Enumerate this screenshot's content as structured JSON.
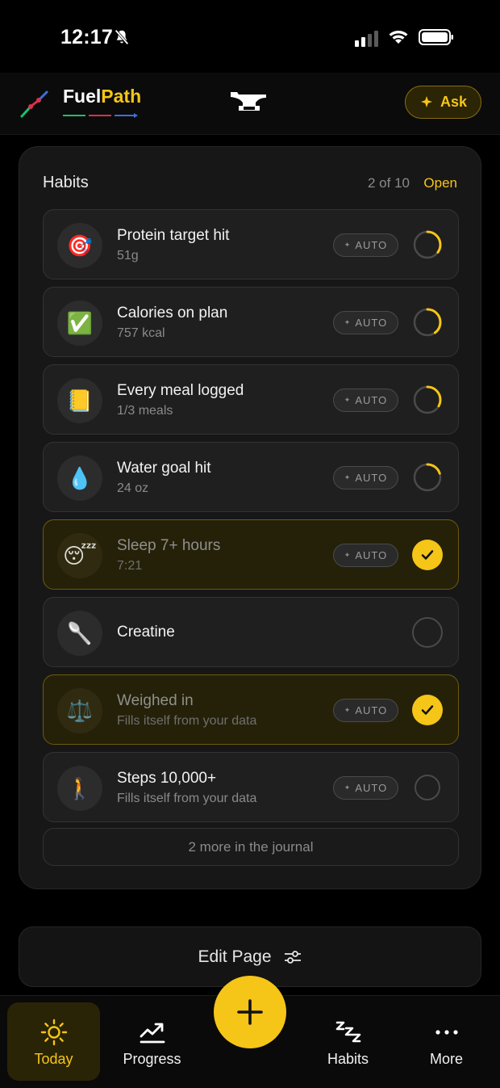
{
  "status": {
    "time": "12:17"
  },
  "header": {
    "brand_part1": "Fuel",
    "brand_part2": "Path",
    "ask_label": "Ask"
  },
  "habits_card": {
    "title": "Habits",
    "count": "2 of 10",
    "open_label": "Open",
    "auto_label": "AUTO",
    "items": [
      {
        "emoji": "🎯",
        "name": "Protein target hit",
        "sub": "51g",
        "state": "partial",
        "progress": 0.35
      },
      {
        "emoji": "✅",
        "name": "Calories on plan",
        "sub": "757 kcal",
        "state": "partial",
        "progress": 0.4
      },
      {
        "emoji": "📒",
        "name": "Every meal logged",
        "sub": "1/3 meals",
        "state": "partial",
        "progress": 0.33
      },
      {
        "emoji": "💧",
        "name": "Water goal hit",
        "sub": "24 oz",
        "state": "partial",
        "progress": 0.2
      },
      {
        "emoji": "😴",
        "name": "Sleep 7+ hours",
        "sub": "7:21",
        "state": "done"
      },
      {
        "emoji": "🥄",
        "name": "Creatine",
        "sub": "",
        "state": "empty"
      },
      {
        "emoji": "⚖️",
        "name": "Weighed in",
        "sub": "Fills itself from your data",
        "state": "done"
      },
      {
        "emoji": "🚶",
        "name": "Steps 10,000+",
        "sub": "Fills itself from your data",
        "state": "empty"
      }
    ],
    "more_label": "2 more in the journal"
  },
  "edit_page_label": "Edit Page",
  "tabs": [
    {
      "label": "Today",
      "icon": "sun-icon",
      "active": true
    },
    {
      "label": "Progress",
      "icon": "trend-up-icon",
      "active": false
    },
    {
      "label": "Habits",
      "icon": "zzz-icon",
      "active": false
    },
    {
      "label": "More",
      "icon": "more-dots-icon",
      "active": false
    }
  ],
  "colors": {
    "accent": "#f5c518",
    "background": "#000000",
    "card": "#171717"
  }
}
